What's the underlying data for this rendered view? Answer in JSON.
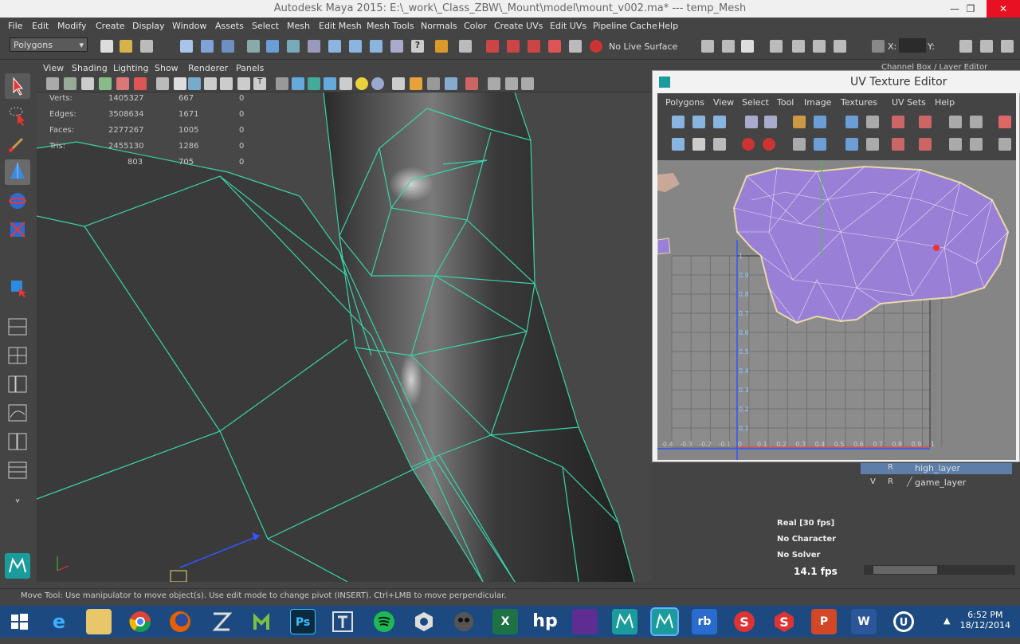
{
  "window": {
    "title": "Autodesk Maya 2015: E:\\_work\\_Class_ZBW\\_Mount\\model\\mount_v002.ma*   ---   temp_Mesh",
    "controls": [
      "—",
      "❐",
      "✕"
    ]
  },
  "menubar": [
    "File",
    "Edit",
    "Modify",
    "Create",
    "Display",
    "Window",
    "Assets",
    "Select",
    "Mesh",
    "Edit Mesh",
    "Mesh Tools",
    "Normals",
    "Color",
    "Create UVs",
    "Edit UVs",
    "Pipeline Cache",
    "Help"
  ],
  "shelf": {
    "mode_dropdown": "Polygons",
    "live_surface": "No Live Surface",
    "x_label": "X:",
    "y_label": "Y:"
  },
  "panel_menu": [
    "View",
    "Shading",
    "Lighting",
    "Show",
    "Renderer",
    "Panels"
  ],
  "hud": {
    "rows": [
      {
        "label": "Verts:",
        "a": "1405327",
        "b": "667",
        "c": "0"
      },
      {
        "label": "Edges:",
        "a": "3508634",
        "b": "1671",
        "c": "0"
      },
      {
        "label": "Faces:",
        "a": "2277267",
        "b": "1005",
        "c": "0"
      },
      {
        "label": "Tris:",
        "a": "2455130",
        "b": "1286",
        "c": "0"
      },
      {
        "label": "",
        "a": "803",
        "b": "705",
        "c": "0"
      }
    ]
  },
  "hud_right": {
    "fps_real": "Real [30 fps]",
    "character": "No Character",
    "solver": "No Solver",
    "fps_value": "14.1 fps"
  },
  "uv_editor": {
    "title": "UV Texture Editor",
    "menu": [
      "Polygons",
      "View",
      "Select",
      "Tool",
      "Image",
      "Textures",
      "UV Sets",
      "Help"
    ],
    "v_ticks": [
      "1",
      "0.9",
      "0.8",
      "0.7",
      "0.6",
      "0.5",
      "0.4",
      "0.3",
      "0.2",
      "0.1"
    ],
    "u_ticks": [
      "-0.4",
      "-0.3",
      "-0.2",
      "-0.1",
      "0",
      "0.1",
      "0.2",
      "0.3",
      "0.4",
      "0.5",
      "0.6",
      "0.7",
      "0.8",
      "0.9",
      "1"
    ]
  },
  "channel_box": {
    "header": "Channel Box / Layer Editor",
    "layers": [
      {
        "v": "",
        "r": "R",
        "name": "high_layer",
        "selected": true
      },
      {
        "v": "V",
        "r": "R",
        "name": "game_layer",
        "selected": false
      }
    ]
  },
  "status_line": "Move Tool: Use manipulator to move object(s). Use edit mode to change pivot (INSERT). Ctrl+LMB to move perpendicular.",
  "taskbar": {
    "apps": [
      "windows-start",
      "ie",
      "explorer",
      "chrome",
      "firefox",
      "zbrush",
      "mudbox",
      "photoshop",
      "unity-t",
      "spotify",
      "c-app",
      "mask",
      "excel",
      "hp",
      "maya-lt-a",
      "maya",
      "maya-active",
      "rb",
      "s-app",
      "s-app-2",
      "powerpoint",
      "word",
      "unreal"
    ],
    "labels": {
      "photoshop": "Ps",
      "excel": "X",
      "hp": "hp",
      "word": "W",
      "powerpoint": "P",
      "rb": "rb"
    },
    "time": "6:52 PM",
    "date": "18/12/2014"
  },
  "colors": {
    "wire": "#39d4a8",
    "uv_fill": "#9a7fd6",
    "accent_blue": "#1c4a80"
  }
}
